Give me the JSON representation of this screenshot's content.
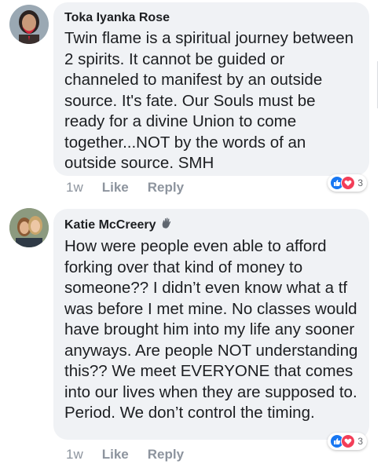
{
  "comments": [
    {
      "author": "Toka Iyanka Rose",
      "text": "Twin flame is a spiritual journey between 2 spirits. It cannot be guided or channeled to manifest by an outside source. It's fate. Our Souls must be ready for a divine Union to come together...NOT by the words of an outside source. SMH",
      "time": "1w",
      "like_label": "Like",
      "reply_label": "Reply",
      "reaction_count": "3",
      "avatar_icon": "avatar-photo",
      "has_badge": false
    },
    {
      "author": "Katie McCreery",
      "text": "How were people even able to afford forking over that kind of money to someone?? I didn’t even know what a tf was before I met mine. No classes would have brought him into my life any sooner anyways. Are people NOT understanding this?? We meet EVERYONE that comes into our lives when they are supposed to. Period. We don’t control the timing.",
      "time": "1w",
      "like_label": "Like",
      "reply_label": "Reply",
      "reaction_count": "3",
      "avatar_icon": "avatar-photo",
      "badge_icon": "wave-hand-icon",
      "has_badge": true
    }
  ],
  "colors": {
    "bubble": "#f0f2f5",
    "like": "#1877f2",
    "love": "#f33e58",
    "meta": "#8d949e"
  }
}
